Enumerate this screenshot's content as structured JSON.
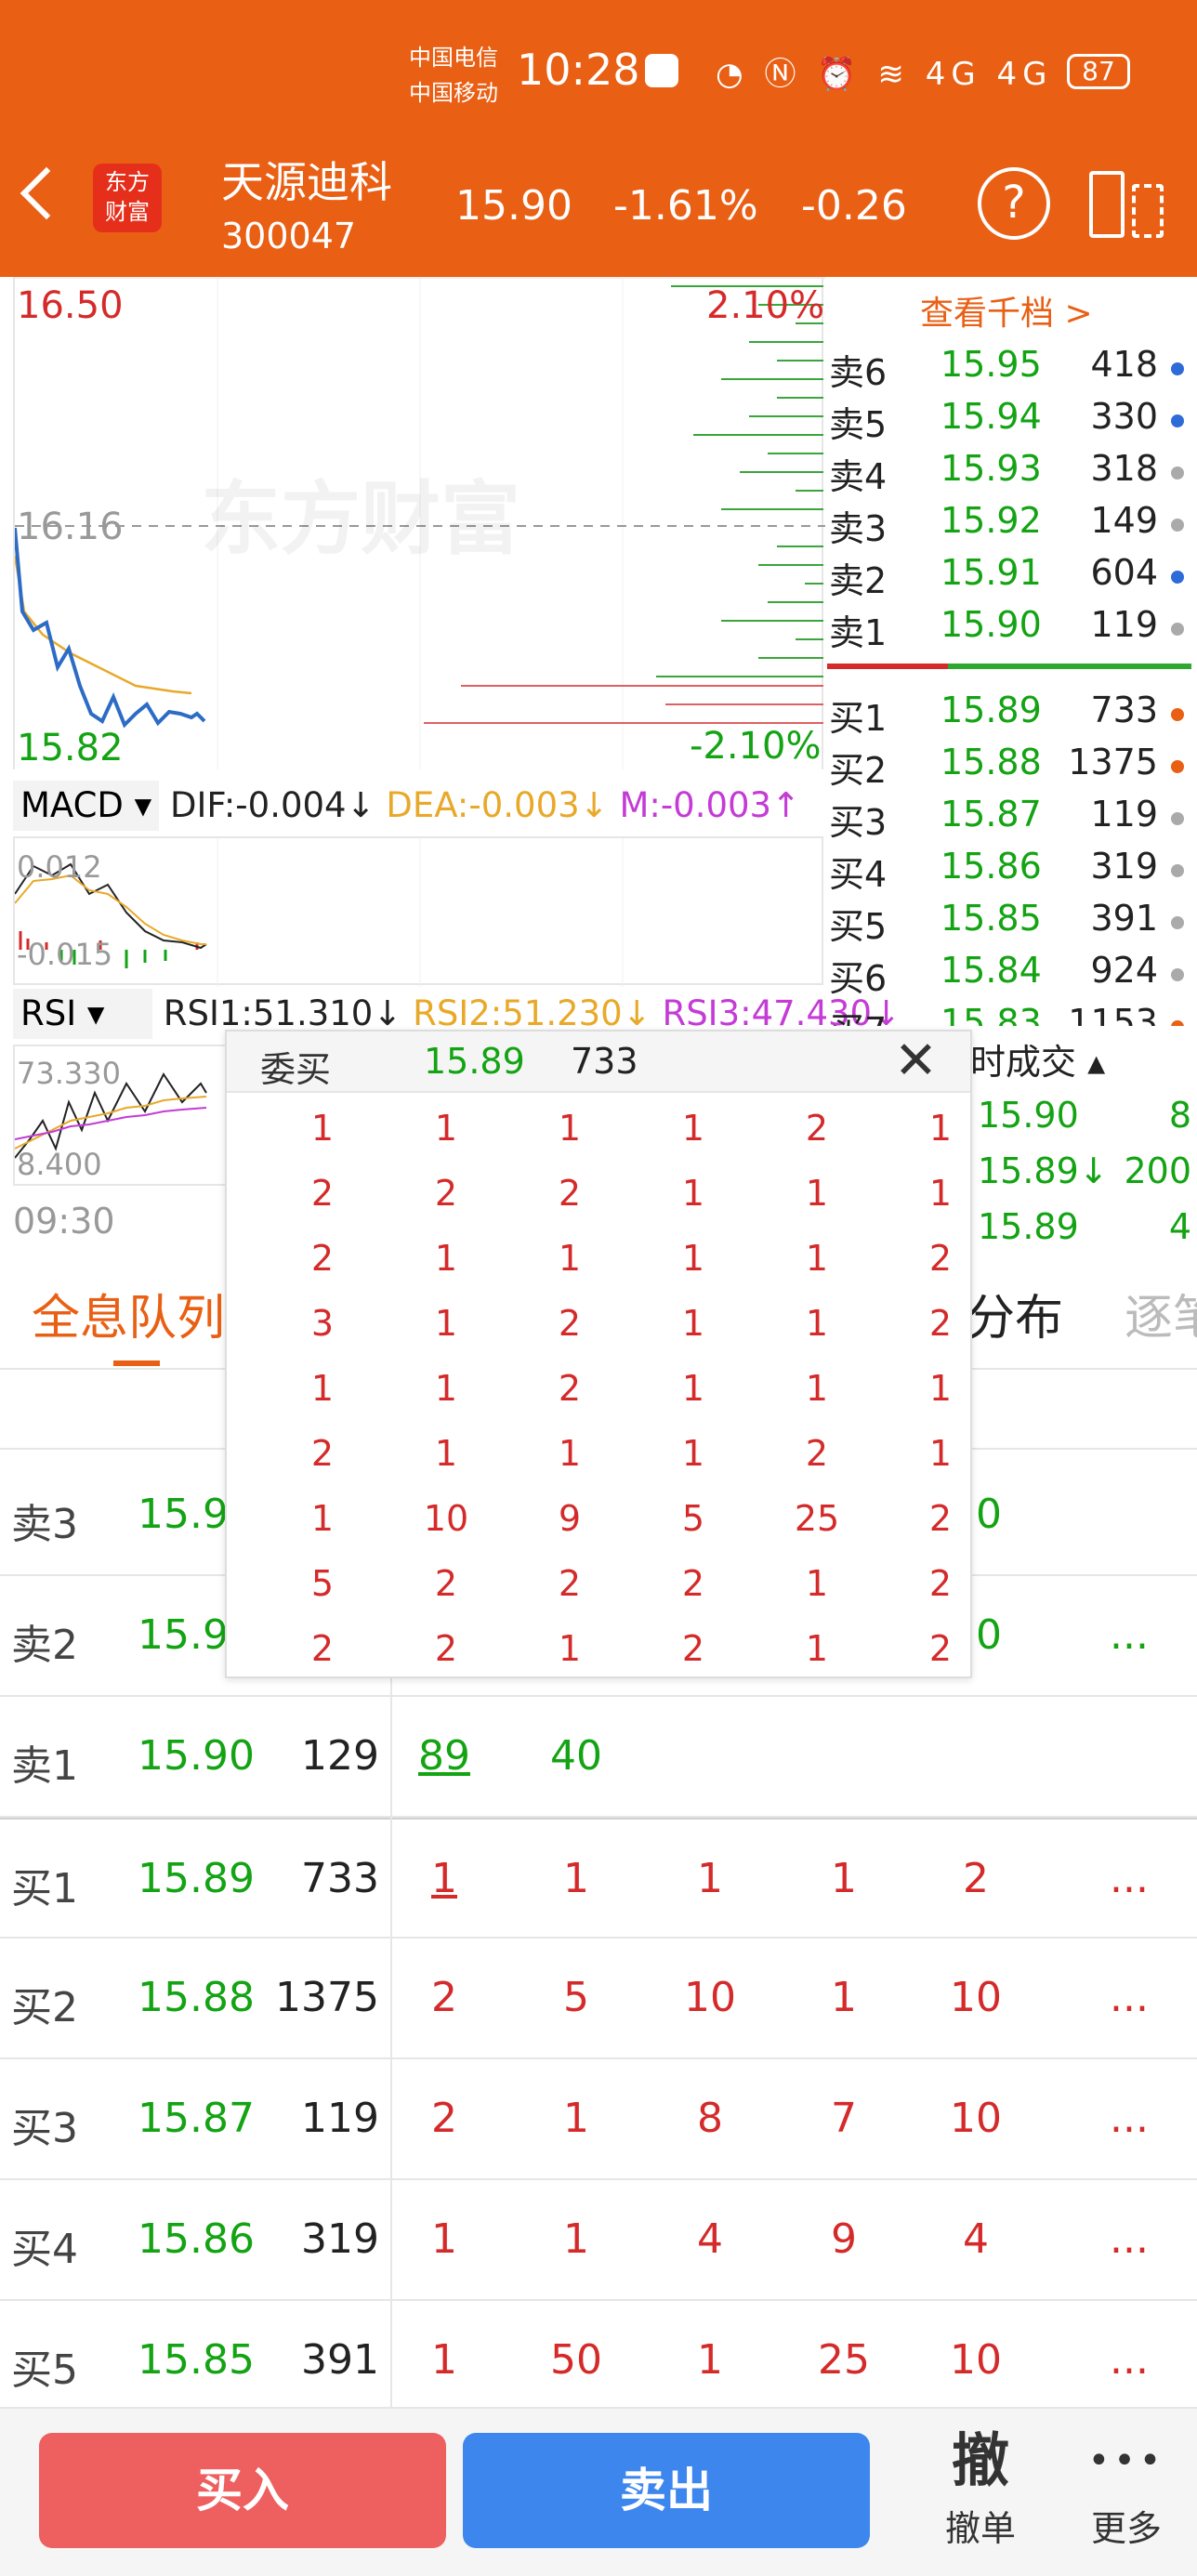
{
  "status_bar": {
    "carrier1": "中国电信",
    "carrier2": "中国移动",
    "time": "10:28",
    "battery": "87"
  },
  "header": {
    "stock_name": "天源迪科",
    "stock_code": "300047",
    "price": "15.90",
    "change_pct": "-1.61%",
    "change": "-0.26",
    "logo_text_1": "东方",
    "logo_text_2": "财富"
  },
  "chart": {
    "price_high": "16.50",
    "pct_high": "2.10%",
    "price_mid": "16.16",
    "price_low": "15.82",
    "pct_low": "-2.10%",
    "watermark": "东方财富",
    "time_label": "09:30"
  },
  "macd": {
    "name": "MACD",
    "dif": "DIF:-0.004",
    "dea": "DEA:-0.003",
    "m": "M:-0.003",
    "arrow_down": "↓",
    "arrow_up": "↑",
    "tick_top": "0.012",
    "tick_bottom": "-0.015"
  },
  "rsi": {
    "name": "RSI",
    "rsi1": "RSI1:51.310",
    "rsi2": "RSI2:51.230",
    "rsi3": "RSI3:47.430",
    "arrow": "↓",
    "tick_top": "73.330",
    "tick_bottom": "8.400"
  },
  "order_book": {
    "link": "查看千档 >",
    "asks": [
      {
        "label": "卖6",
        "price": "15.95",
        "vol": "418",
        "dot": "#2f6bd8"
      },
      {
        "label": "卖5",
        "price": "15.94",
        "vol": "330",
        "dot": "#2f6bd8"
      },
      {
        "label": "卖4",
        "price": "15.93",
        "vol": "318",
        "dot": "#aaaaaa"
      },
      {
        "label": "卖3",
        "price": "15.92",
        "vol": "149",
        "dot": "#aaaaaa"
      },
      {
        "label": "卖2",
        "price": "15.91",
        "vol": "604",
        "dot": "#2f6bd8"
      },
      {
        "label": "卖1",
        "price": "15.90",
        "vol": "119",
        "dot": "#aaaaaa"
      }
    ],
    "bids": [
      {
        "label": "买1",
        "price": "15.89",
        "vol": "733",
        "dot": "#e95f14"
      },
      {
        "label": "买2",
        "price": "15.88",
        "vol": "1375",
        "dot": "#e95f14"
      },
      {
        "label": "买3",
        "price": "15.87",
        "vol": "119",
        "dot": "#aaaaaa"
      },
      {
        "label": "买4",
        "price": "15.86",
        "vol": "319",
        "dot": "#aaaaaa"
      },
      {
        "label": "买5",
        "price": "15.85",
        "vol": "391",
        "dot": "#aaaaaa"
      },
      {
        "label": "买6",
        "price": "15.84",
        "vol": "924",
        "dot": "#aaaaaa"
      },
      {
        "label": "买7",
        "price": "15.83",
        "vol": "1153",
        "dot": "#e95f14"
      }
    ]
  },
  "trades": {
    "title": "时成交",
    "rows": [
      {
        "price": "15.90",
        "vol": "8"
      },
      {
        "price": "15.89↓",
        "vol": "200"
      },
      {
        "price": "15.89",
        "vol": "4"
      }
    ]
  },
  "tabs": {
    "queue": "全息队列",
    "dist": "分布",
    "detail": "逐笔"
  },
  "popup": {
    "title": "委买",
    "price": "15.89",
    "vol": "733",
    "rows": [
      [
        "1",
        "1",
        "1",
        "1",
        "2",
        "1"
      ],
      [
        "2",
        "2",
        "2",
        "1",
        "1",
        "1"
      ],
      [
        "2",
        "1",
        "1",
        "1",
        "1",
        "2"
      ],
      [
        "3",
        "1",
        "2",
        "1",
        "1",
        "2"
      ],
      [
        "1",
        "1",
        "2",
        "1",
        "1",
        "1"
      ],
      [
        "2",
        "1",
        "1",
        "1",
        "2",
        "1"
      ],
      [
        "1",
        "10",
        "9",
        "5",
        "25",
        "2"
      ],
      [
        "5",
        "2",
        "2",
        "2",
        "1",
        "2"
      ],
      [
        "2",
        "2",
        "1",
        "2",
        "1",
        "2"
      ]
    ]
  },
  "queue": {
    "more": "...",
    "rows": [
      {
        "label": "卖3",
        "price": "15.9",
        "vol": "",
        "q": [
          "",
          "",
          "",
          "",
          "10"
        ],
        "more": false
      },
      {
        "label": "卖2",
        "price": "15.9",
        "vol": "",
        "q": [
          "",
          "",
          "",
          "",
          "10"
        ],
        "more": true
      },
      {
        "label": "卖1",
        "price": "15.90",
        "vol": "129",
        "q": [
          "89",
          "40",
          "",
          "",
          ""
        ],
        "more": false
      },
      {
        "label": "买1",
        "price": "15.89",
        "vol": "733",
        "q": [
          "1",
          "1",
          "1",
          "1",
          "2"
        ],
        "more": true
      },
      {
        "label": "买2",
        "price": "15.88",
        "vol": "1375",
        "q": [
          "2",
          "5",
          "10",
          "1",
          "10"
        ],
        "more": true
      },
      {
        "label": "买3",
        "price": "15.87",
        "vol": "119",
        "q": [
          "2",
          "1",
          "8",
          "7",
          "10"
        ],
        "more": true
      },
      {
        "label": "买4",
        "price": "15.86",
        "vol": "319",
        "q": [
          "1",
          "1",
          "4",
          "9",
          "4"
        ],
        "more": true
      },
      {
        "label": "买5",
        "price": "15.85",
        "vol": "391",
        "q": [
          "1",
          "50",
          "1",
          "25",
          "10"
        ],
        "more": true
      }
    ]
  },
  "bottom": {
    "buy": "买入",
    "sell": "卖出",
    "cancel_glyph": "撤",
    "cancel": "撤单",
    "more_glyph": "•••",
    "more": "更多"
  }
}
